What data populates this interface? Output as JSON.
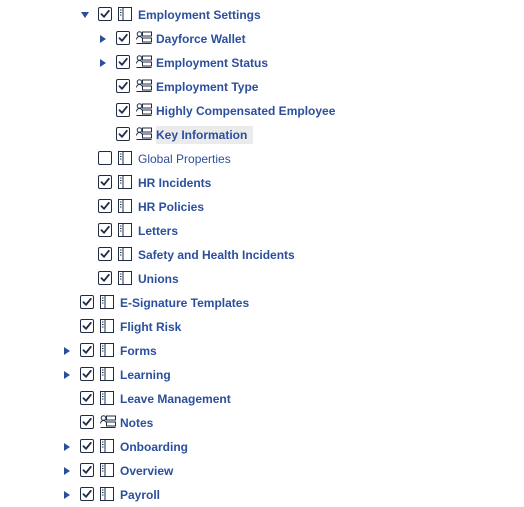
{
  "tree": {
    "items": [
      {
        "label": "Employment Settings",
        "level": 1,
        "expander": "expanded",
        "checked": true,
        "icon": "list-panel-icon",
        "bold": true
      },
      {
        "label": "Dayforce Wallet",
        "level": 2,
        "expander": "collapsed",
        "checked": true,
        "icon": "form-panel-icon",
        "bold": true
      },
      {
        "label": "Employment Status",
        "level": 2,
        "expander": "collapsed",
        "checked": true,
        "icon": "form-panel-icon",
        "bold": true
      },
      {
        "label": "Employment Type",
        "level": 2,
        "expander": "none",
        "checked": true,
        "icon": "form-panel-icon",
        "bold": true
      },
      {
        "label": "Highly Compensated Employee",
        "level": 2,
        "expander": "none",
        "checked": true,
        "icon": "form-panel-icon",
        "bold": true
      },
      {
        "label": "Key Information",
        "level": 2,
        "expander": "none",
        "checked": true,
        "icon": "form-panel-icon",
        "bold": true,
        "highlighted": true
      },
      {
        "label": "Global Properties",
        "level": 1,
        "expander": "none",
        "checked": false,
        "icon": "list-panel-icon",
        "bold": false
      },
      {
        "label": "HR Incidents",
        "level": 1,
        "expander": "none",
        "checked": true,
        "icon": "list-panel-icon",
        "bold": true
      },
      {
        "label": "HR Policies",
        "level": 1,
        "expander": "none",
        "checked": true,
        "icon": "list-panel-icon",
        "bold": true
      },
      {
        "label": "Letters",
        "level": 1,
        "expander": "none",
        "checked": true,
        "icon": "list-panel-icon",
        "bold": true
      },
      {
        "label": "Safety and Health Incidents",
        "level": 1,
        "expander": "none",
        "checked": true,
        "icon": "list-panel-icon",
        "bold": true
      },
      {
        "label": "Unions",
        "level": 1,
        "expander": "none",
        "checked": true,
        "icon": "list-panel-icon",
        "bold": true
      },
      {
        "label": "E-Signature Templates",
        "level": 0,
        "expander": "none",
        "checked": true,
        "icon": "list-panel-icon",
        "bold": true
      },
      {
        "label": "Flight Risk",
        "level": 0,
        "expander": "none",
        "checked": true,
        "icon": "list-panel-icon",
        "bold": true
      },
      {
        "label": "Forms",
        "level": 0,
        "expander": "collapsed",
        "checked": true,
        "icon": "list-panel-icon",
        "bold": true
      },
      {
        "label": "Learning",
        "level": 0,
        "expander": "collapsed",
        "checked": true,
        "icon": "list-panel-icon",
        "bold": true
      },
      {
        "label": "Leave Management",
        "level": 0,
        "expander": "none",
        "checked": true,
        "icon": "list-panel-icon",
        "bold": true
      },
      {
        "label": "Notes",
        "level": 0,
        "expander": "none",
        "checked": true,
        "icon": "form-panel-icon",
        "bold": true
      },
      {
        "label": "Onboarding",
        "level": 0,
        "expander": "collapsed",
        "checked": true,
        "icon": "list-panel-icon",
        "bold": true
      },
      {
        "label": "Overview",
        "level": 0,
        "expander": "collapsed",
        "checked": true,
        "icon": "list-panel-icon",
        "bold": true
      },
      {
        "label": "Payroll",
        "level": 0,
        "expander": "collapsed",
        "checked": true,
        "icon": "list-panel-icon",
        "bold": true
      }
    ]
  },
  "colors": {
    "label": "#2c4f9c",
    "icon": "#1f2d44",
    "highlight": "#ebebeb"
  }
}
